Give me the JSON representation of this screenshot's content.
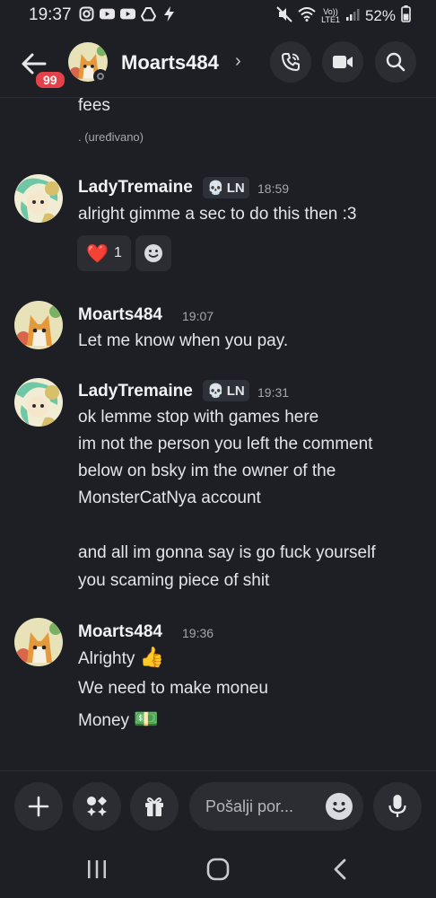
{
  "status": {
    "time": "19:37",
    "battery": "52%",
    "network_top": "Vo))",
    "network_bottom": "LTE1",
    "left_icons": [
      "instagram-icon",
      "youtube-icon",
      "youtube-icon",
      "drive-icon",
      "bolt-icon"
    ],
    "right_icons": [
      "mute-icon",
      "wifi-icon",
      "signal-icon",
      "battery-icon"
    ]
  },
  "header": {
    "unread_badge": "99",
    "username": "Moarts484",
    "chevron": "›"
  },
  "messages": {
    "m0": {
      "lines": [
        "fees"
      ],
      "edited": ". (uređivano)"
    },
    "m1": {
      "author": "LadyTremaine",
      "tag": "LN",
      "tag_icon": "skull-emoji",
      "time": "18:59",
      "lines": [
        "alright gimme a sec to do this then :3"
      ],
      "reaction": {
        "emoji": "❤️",
        "count": "1"
      }
    },
    "m2": {
      "author": "Moarts484",
      "time": "19:07",
      "lines": [
        "Let me know when you pay."
      ]
    },
    "m3": {
      "author": "LadyTremaine",
      "tag": "LN",
      "tag_icon": "skull-emoji",
      "time": "19:31",
      "lines": [
        "ok lemme stop with games here",
        "im not the person you left the comment",
        "below on bsky im the owner of the",
        "MonsterCatNya account",
        "and all im gonna say is go fuck yourself",
        "you scaming piece of shit"
      ]
    },
    "m4": {
      "author": "Moarts484",
      "time": "19:36",
      "lines": [
        "Alrighty",
        "We need to make moneu",
        "Money"
      ],
      "emoji": [
        "👍",
        "💵"
      ]
    }
  },
  "composer": {
    "placeholder": "Pošalji por..."
  },
  "colors": {
    "bg": "#1e1f24",
    "surface": "#2b2d33",
    "badge_red": "#e3424a",
    "heart": "#e2434b",
    "muted_text": "#a5a7ad"
  }
}
